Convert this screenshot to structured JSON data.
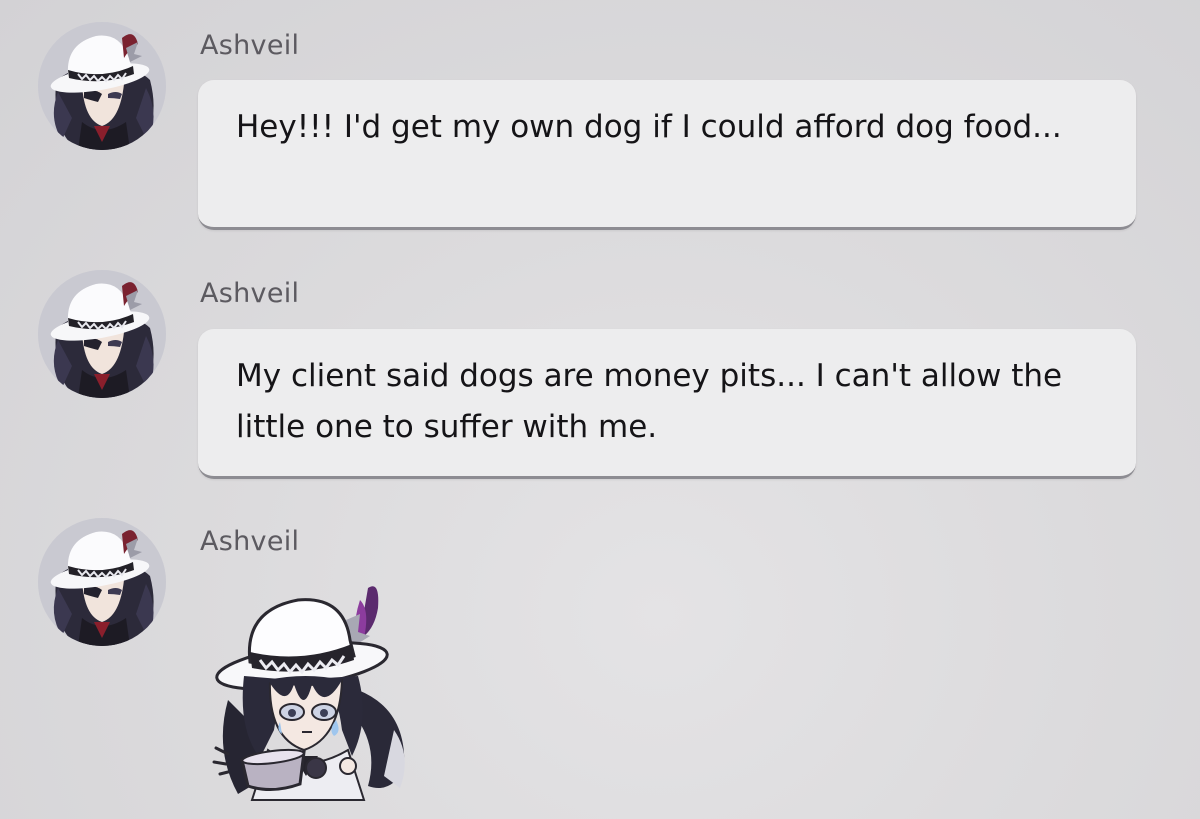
{
  "chat": {
    "messages": [
      {
        "sender": "Ashveil",
        "text": "Hey!!! I'd get my own dog if I could afford dog food..."
      },
      {
        "sender": "Ashveil",
        "text": "My client said dogs are money pits... I can't allow the little one to suffer with me."
      },
      {
        "sender": "Ashveil",
        "sticker": "chibi-crying-with-empty-bowl"
      }
    ]
  },
  "colors": {
    "background": "#dcdbdd",
    "bubble": "#ededee",
    "bubble_border": "#8d8c92",
    "sender_name": "#5c5a60",
    "message_text": "#151417"
  }
}
